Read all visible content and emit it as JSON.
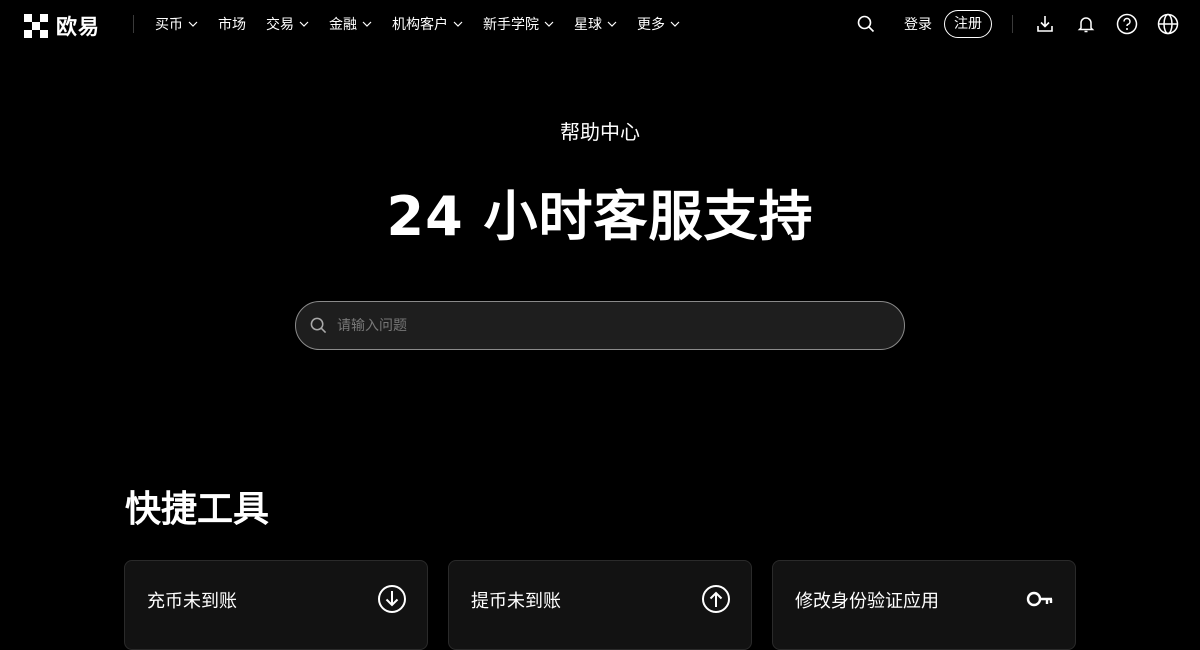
{
  "brand": {
    "name": "欧易"
  },
  "nav": {
    "items": [
      {
        "label": "买币",
        "dropdown": true
      },
      {
        "label": "市场",
        "dropdown": false
      },
      {
        "label": "交易",
        "dropdown": true
      },
      {
        "label": "金融",
        "dropdown": true
      },
      {
        "label": "机构客户",
        "dropdown": true
      },
      {
        "label": "新手学院",
        "dropdown": true
      },
      {
        "label": "星球",
        "dropdown": true
      },
      {
        "label": "更多",
        "dropdown": true
      }
    ],
    "login_label": "登录",
    "register_label": "注册",
    "icons": [
      "search-icon",
      "download-icon",
      "bell-icon",
      "help-icon",
      "globe-icon"
    ]
  },
  "hero": {
    "subtitle": "帮助中心",
    "title": "24 小时客服支持",
    "search_placeholder": "请输入问题"
  },
  "quick_tools": {
    "title": "快捷工具",
    "cards": [
      {
        "label": "充币未到账",
        "icon": "download-circle-icon"
      },
      {
        "label": "提币未到账",
        "icon": "upload-circle-icon"
      },
      {
        "label": "修改身份验证应用",
        "icon": "key-icon"
      }
    ]
  },
  "colors": {
    "background": "#000000",
    "text": "#ffffff",
    "card": "#121212"
  }
}
